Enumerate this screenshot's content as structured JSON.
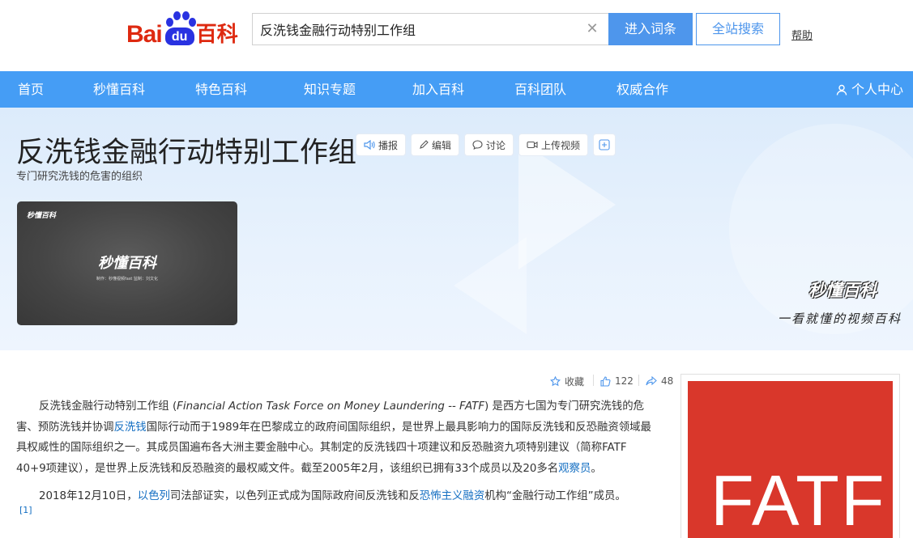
{
  "header": {
    "logo": {
      "bai": "Bai",
      "du": "du",
      "baike": "百科"
    },
    "search": {
      "value": "反洗钱金融行动特别工作组",
      "clear_icon": "close-icon"
    },
    "enter_button": "进入词条",
    "site_search_button": "全站搜索",
    "help_link": "帮助"
  },
  "nav": {
    "items": [
      "首页",
      "秒懂百科",
      "特色百科",
      "知识专题",
      "加入百科",
      "百科团队",
      "权威合作"
    ],
    "user_center": "个人中心"
  },
  "banner": {
    "title": "反洗钱金融行动特别工作组",
    "subtitle": "专门研究洗钱的危害的组织",
    "tools": {
      "play": "播报",
      "edit": "编辑",
      "discuss": "讨论",
      "upload_video": "上传视频",
      "add": "+"
    },
    "video": {
      "small_logo": "秒懂百科",
      "big_logo": "秒懂百科",
      "credits": "制作：秒懂视频fast   监制：刘文化"
    },
    "miaodong_logo": "秒懂百科",
    "slogan": "一看就懂的视频百科"
  },
  "article": {
    "stats": {
      "collect": "收藏",
      "likes": "122",
      "shares": "48"
    },
    "para1": {
      "name": "反洗钱金融行动特别工作组 (",
      "en_name": "Financial Action Task Force on Money Laundering -- FATF",
      "t1": ") 是西方七国为专门研究洗钱的危害、预防洗钱并协调",
      "link1": "反洗钱",
      "t2": "国际行动而于1989年在巴黎成立的政府间国际组织，是世界上最具影响力的国际反洗钱和反恐融资领域最具权威性的国际组织之一。其成员国遍布各大洲主要金融中心。其制定的反洗钱四十项建议和反恐融资九项特别建议（简称FATF 40+9项建议），是世界上反洗钱和反恐融资的最权威文件。截至2005年2月，该组织已拥有33个成员以及20多名",
      "link2": "观察员",
      "t3": "。"
    },
    "para2": {
      "t1": "2018年12月10日，",
      "link1": "以色列",
      "t2": "司法部证实，以色列正式成为国际政府间反洗钱和反",
      "link2": "恐怖主义融资",
      "t3": "机构“金融行动工作组”成员。"
    },
    "ref": "[1]"
  },
  "image": {
    "text": "FATF",
    "color": "#d9372b"
  }
}
